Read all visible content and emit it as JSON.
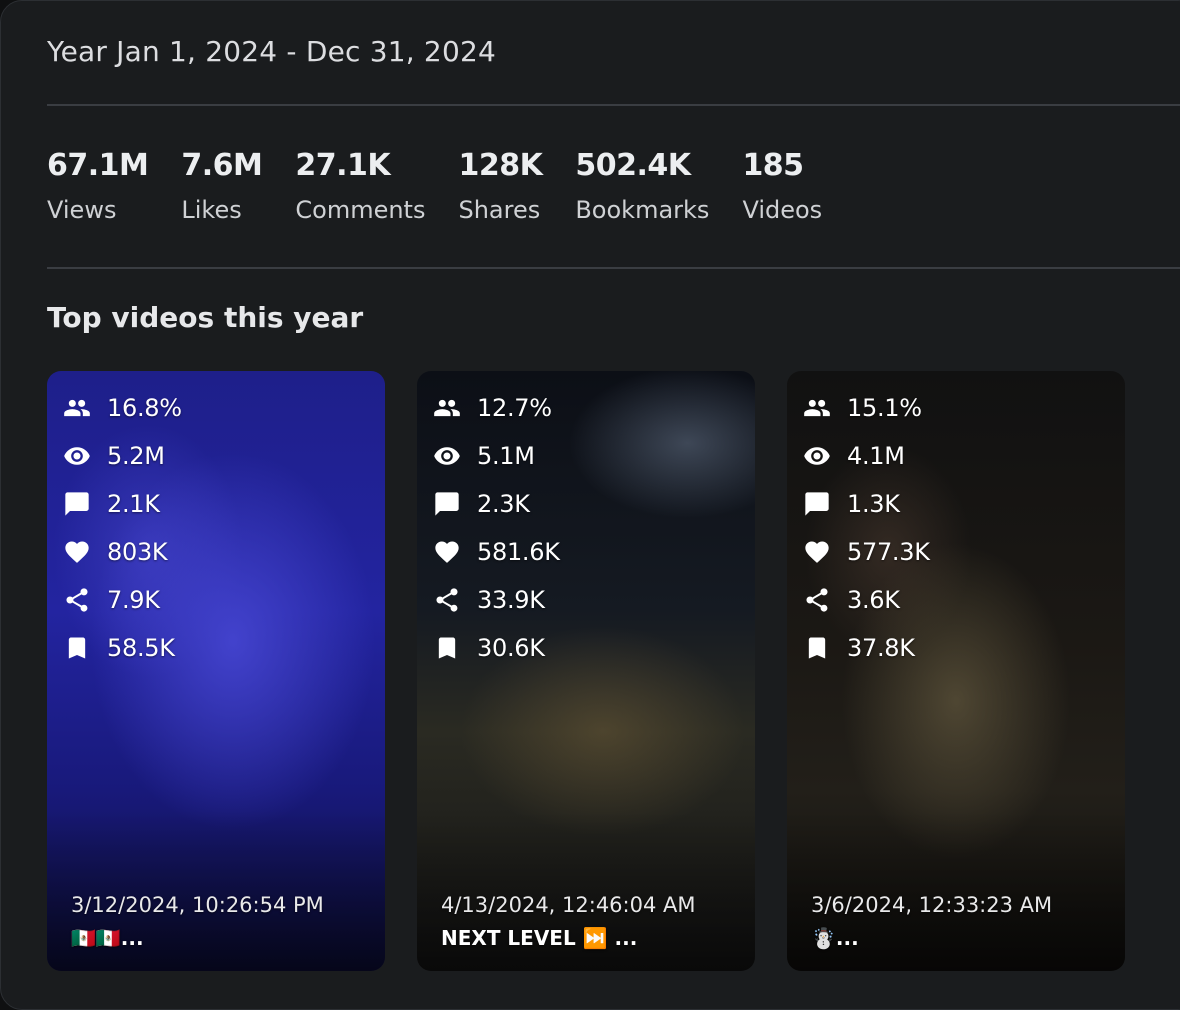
{
  "period": "Year Jan 1, 2024 - Dec 31, 2024",
  "stats": [
    {
      "value": "67.1M",
      "label": "Views"
    },
    {
      "value": "7.6M",
      "label": "Likes"
    },
    {
      "value": "27.1K",
      "label": "Comments"
    },
    {
      "value": "128K",
      "label": "Shares"
    },
    {
      "value": "502.4K",
      "label": "Bookmarks"
    },
    {
      "value": "185",
      "label": "Videos"
    }
  ],
  "top_videos_title": "Top videos this year",
  "icons": [
    "users-icon",
    "eye-icon",
    "comment-icon",
    "heart-icon",
    "share-icon",
    "bookmark-icon"
  ],
  "videos": [
    {
      "audience": "16.8%",
      "views": "5.2M",
      "comments": "2.1K",
      "likes": "803K",
      "shares": "7.9K",
      "bookmarks": "58.5K",
      "date": "3/12/2024, 10:26:54 PM",
      "caption": "🇲🇽🇲🇽..."
    },
    {
      "audience": "12.7%",
      "views": "5.1M",
      "comments": "2.3K",
      "likes": "581.6K",
      "shares": "33.9K",
      "bookmarks": "30.6K",
      "date": "4/13/2024, 12:46:04 AM",
      "caption": "NEXT LEVEL ⏭️ ..."
    },
    {
      "audience": "15.1%",
      "views": "4.1M",
      "comments": "1.3K",
      "likes": "577.3K",
      "shares": "3.6K",
      "bookmarks": "37.8K",
      "date": "3/6/2024, 12:33:23 AM",
      "caption": "☃️..."
    }
  ]
}
